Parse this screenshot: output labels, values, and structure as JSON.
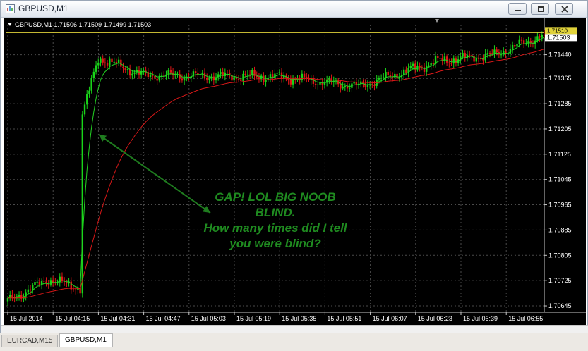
{
  "window": {
    "title": "GBPUSD,M1"
  },
  "chart": {
    "header": "GBPUSD,M1  1.71506 1.71509 1.71499 1.71503",
    "annotation_lines": [
      "GAP! LOL BIG NOOB",
      "BLIND.",
      "How many times did I tell",
      "you were blind?"
    ],
    "price_label_top": "1.71510",
    "price_label_current": "1.71503"
  },
  "colors": {
    "background": "#000000",
    "grid": "#4a4a4a",
    "bull_candle": "#19d419",
    "bear_candle": "#e11717",
    "fast_ma": "#23d423",
    "slow_ma": "#d81818",
    "annotation": "#1f8b20",
    "price_line": "#e0d23a"
  },
  "tabs": [
    {
      "label": "EURCAD,M15",
      "active": false
    },
    {
      "label": "GBPUSD,M1",
      "active": true
    }
  ],
  "icons": [
    "chart-app-icon",
    "minimize-icon",
    "maximize-icon",
    "close-icon"
  ],
  "chart_data": {
    "type": "candlestick",
    "symbol": "GBPUSD",
    "timeframe": "M1",
    "y_ticks": [
      1.7144,
      1.71365,
      1.71285,
      1.71205,
      1.71125,
      1.71045,
      1.70965,
      1.70885,
      1.70805,
      1.70725,
      1.70645
    ],
    "x_ticks": [
      "15 Jul 2014",
      "15 Jul 04:15",
      "15 Jul 04:31",
      "15 Jul 04:47",
      "15 Jul 05:03",
      "15 Jul 05:19",
      "15 Jul 05:35",
      "15 Jul 05:51",
      "15 Jul 06:07",
      "15 Jul 06:23",
      "15 Jul 06:39",
      "15 Jul 06:55"
    ],
    "ylim": [
      1.70625,
      1.71535
    ],
    "grid": true,
    "last_quote": {
      "open": 1.71506,
      "high": 1.71509,
      "low": 1.71499,
      "close": 1.71503
    },
    "key_points": [
      {
        "index": 0,
        "close": 1.7066
      },
      {
        "index": 18,
        "close": 1.7073
      },
      {
        "index": 32,
        "close": 1.707
      },
      {
        "index": 33,
        "close": 1.7125
      },
      {
        "index": 40,
        "close": 1.7143
      },
      {
        "index": 60,
        "close": 1.71375
      },
      {
        "index": 120,
        "close": 1.7137
      },
      {
        "index": 155,
        "close": 1.7134
      },
      {
        "index": 190,
        "close": 1.7142
      },
      {
        "index": 215,
        "close": 1.7144
      },
      {
        "index": 237,
        "close": 1.71503
      }
    ]
  }
}
